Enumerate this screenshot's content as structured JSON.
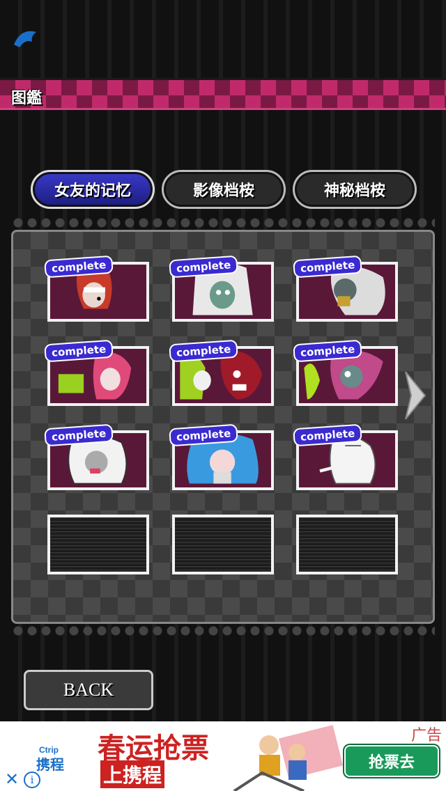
{
  "header": {
    "title": "图鑑"
  },
  "tabs": [
    {
      "label": "女友的记忆",
      "active": true
    },
    {
      "label": "影像档桉",
      "active": false
    },
    {
      "label": "神秘档桉",
      "active": false
    }
  ],
  "gallery": {
    "badge_label": "complete",
    "cards": [
      {
        "status": "complete",
        "character": "red-haired bandaged girl"
      },
      {
        "status": "complete",
        "character": "white-haired zombie girl"
      },
      {
        "status": "complete",
        "character": "white-haired girl eating"
      },
      {
        "status": "complete",
        "character": "pink-haired girl with green creature"
      },
      {
        "status": "complete",
        "character": "green-haired girl with red monster"
      },
      {
        "status": "complete",
        "character": "pink-haired girl with bubbles"
      },
      {
        "status": "complete",
        "character": "white hooded girl"
      },
      {
        "status": "complete",
        "character": "blue-haired girl"
      },
      {
        "status": "complete",
        "character": "white stitched ghost"
      },
      {
        "status": "locked"
      },
      {
        "status": "locked"
      },
      {
        "status": "locked"
      }
    ]
  },
  "navigation": {
    "back_label": "BACK"
  },
  "ad": {
    "brand_en": "Ctrip",
    "brand_cn": "携程",
    "headline": "春运抢票",
    "subheadline": "上携程",
    "cta": "抢票去",
    "label": "广告",
    "close_glyph": "✕",
    "info_glyph": "i"
  },
  "colors": {
    "accent": "#c02a6a",
    "tab_active": "#2a2ab0",
    "badge": "#3a2ad0",
    "card_bg": "#5a1838"
  }
}
